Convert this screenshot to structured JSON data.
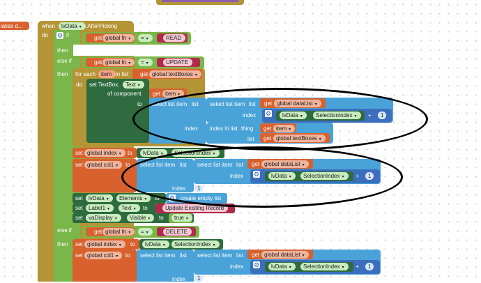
{
  "workspace": {
    "initialize_label": "ialize d...",
    "event": {
      "when": "when",
      "component": "lvData",
      "event_name": ".AfterPicking",
      "do": "do"
    },
    "if_label": "if",
    "then_label": "then",
    "else_if_label": "else if",
    "get_label": "get",
    "set_label": "set",
    "to_label": "to",
    "index_label": "index",
    "list_label": "list",
    "equals": "=",
    "global_fn": "global fn",
    "read": "READ",
    "update": "UPDATE",
    "delete": "DELETE",
    "for_each": "for each",
    "item_var": "item",
    "in_list": "in list",
    "global_textboxes": "global textBoxes",
    "set_textbox": "set TextBox.",
    "text_prop": "Text",
    "of_component": "of component",
    "select_list_item": "select list item",
    "global_datalist": "global dataList",
    "lvdata": "lvData",
    "selection_index": "SelectionIndex",
    "plus": "+",
    "one": "1",
    "index_in_list": "index in list",
    "thing": "thing",
    "global_index": "global index",
    "global_col1": "global col1",
    "elements": "Elements",
    "create_empty_list": "create empty list",
    "label1": "Label1",
    "update_existing": "Update Existing Record",
    "vadisplay": "vaDisplay",
    "visible": "Visible",
    "true_val": "true"
  },
  "colors": {
    "event": "#b49536",
    "control": "#b49536",
    "logic": "#7ab649",
    "variable": "#d8612e",
    "lists": "#4aa3d8",
    "component": "#2e6b3f",
    "math": "#3b6ebd",
    "text": "#b22a49"
  }
}
